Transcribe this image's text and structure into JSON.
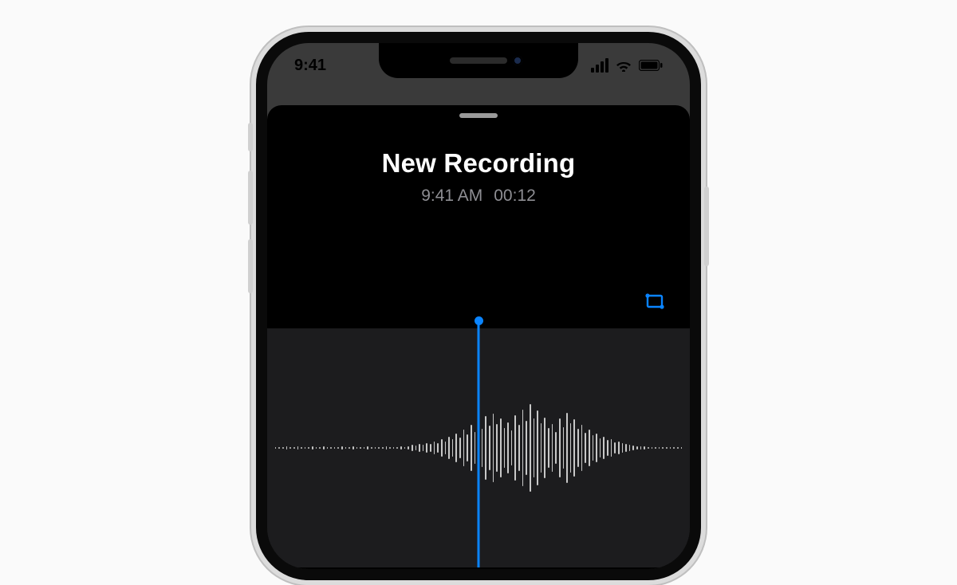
{
  "status": {
    "time": "9:41"
  },
  "recording": {
    "title": "New Recording",
    "time_label": "9:41 AM",
    "duration": "00:12"
  },
  "colors": {
    "accent": "#0a84ff"
  },
  "waveform": {
    "samples": [
      2,
      2,
      2,
      3,
      2,
      2,
      3,
      2,
      2,
      2,
      3,
      2,
      2,
      3,
      2,
      2,
      2,
      2,
      3,
      2,
      2,
      3,
      2,
      2,
      2,
      3,
      2,
      2,
      2,
      2,
      3,
      2,
      2,
      2,
      3,
      2,
      4,
      6,
      5,
      8,
      6,
      10,
      8,
      14,
      10,
      18,
      14,
      24,
      18,
      30,
      22,
      38,
      28,
      48,
      34,
      58,
      40,
      66,
      46,
      72,
      50,
      62,
      42,
      54,
      36,
      68,
      48,
      80,
      56,
      92,
      62,
      78,
      52,
      64,
      42,
      50,
      34,
      62,
      44,
      74,
      52,
      60,
      40,
      48,
      32,
      38,
      26,
      30,
      20,
      24,
      16,
      18,
      12,
      14,
      10,
      8,
      6,
      5,
      4,
      3,
      3,
      2,
      2,
      2,
      2,
      2,
      2,
      2,
      2,
      2,
      2
    ]
  }
}
